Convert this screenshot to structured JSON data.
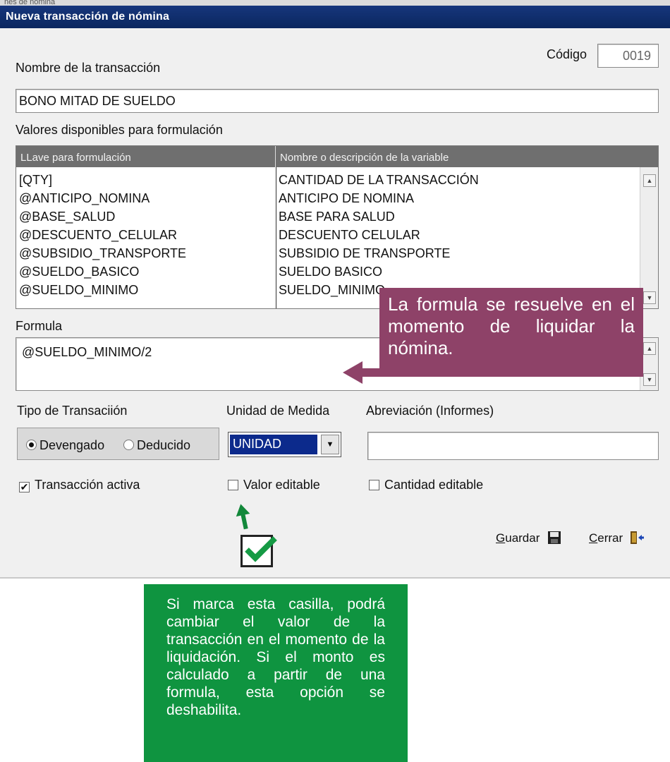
{
  "window": {
    "parent_title": "nes de nómina",
    "title": "Nueva transacción de nómina"
  },
  "codigo": {
    "label": "Código",
    "value": "0019"
  },
  "nombre": {
    "label": "Nombre de la transacción",
    "value": "BONO MITAD DE SUELDO"
  },
  "valores": {
    "label": "Valores disponibles para formulación",
    "columns": [
      "LLave para formulación",
      "Nombre o descripción de la variable"
    ],
    "rows": [
      [
        "[QTY]",
        "CANTIDAD DE LA TRANSACCIÓN"
      ],
      [
        "@ANTICIPO_NOMINA",
        "ANTICIPO DE NOMINA"
      ],
      [
        "@BASE_SALUD",
        "BASE PARA SALUD"
      ],
      [
        "@DESCUENTO_CELULAR",
        "DESCUENTO CELULAR"
      ],
      [
        "@SUBSIDIO_TRANSPORTE",
        "SUBSIDIO DE TRANSPORTE"
      ],
      [
        "@SUELDO_BASICO",
        "SUELDO BASICO"
      ],
      [
        "@SUELDO_MINIMO",
        "SUELDO_MINIMO"
      ]
    ]
  },
  "formula": {
    "label": "Formula",
    "value": "@SUELDO_MINIMO/2"
  },
  "tipo": {
    "label": "Tipo de Transaciión",
    "options": [
      "Devengado",
      "Deducido"
    ],
    "selected": "Devengado"
  },
  "unidad": {
    "label": "Unidad de Medida",
    "value": "UNIDAD"
  },
  "abreviacion": {
    "label": "Abreviación (Informes)",
    "value": ""
  },
  "checks": {
    "activa": {
      "label": "Transacción activa",
      "checked": true
    },
    "valor_editable": {
      "label": "Valor editable",
      "checked": false
    },
    "cantidad_editable": {
      "label": "Cantidad editable",
      "checked": false
    }
  },
  "buttons": {
    "guardar_key": "G",
    "guardar_rest": "uardar",
    "cerrar_key": "C",
    "cerrar_rest": "errar"
  },
  "callouts": {
    "formula": "La formula se resuelve en el momento de liquidar la nómina.",
    "editable": "Si marca esta casilla, podrá cambiar el valor de la transacción en el momento de la liquidación. Si el monto es calculado a partir de una formula, esta opción se deshabilita."
  },
  "colors": {
    "titlebar": "#0c2a6c",
    "callout_purple": "#8e4268",
    "callout_green": "#0f9440",
    "arrow_green": "#12883a",
    "select_highlight": "#0c2a8c"
  },
  "icons": [
    "save-icon",
    "exit-door-icon",
    "scroll-up-icon",
    "scroll-down-icon",
    "dropdown-arrow-icon"
  ]
}
